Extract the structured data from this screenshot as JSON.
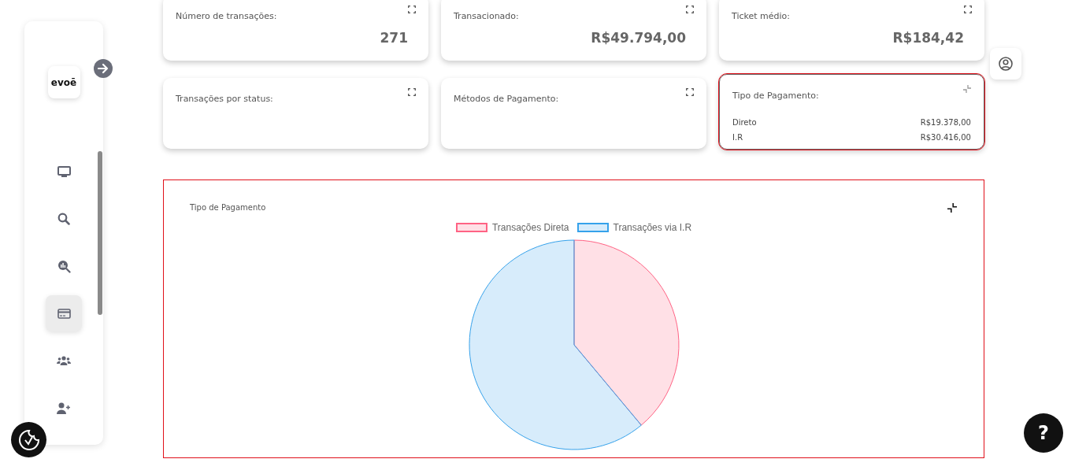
{
  "sidebar": {
    "logo": "evoē",
    "items": [
      {
        "selected": false
      },
      {
        "selected": false
      },
      {
        "selected": false
      },
      {
        "selected": true
      },
      {
        "selected": false
      },
      {
        "selected": false
      }
    ]
  },
  "stat_cards": [
    {
      "title": "Número de transações:",
      "value": "271"
    },
    {
      "title": "Transacionado:",
      "value": "R$49.794,00"
    },
    {
      "title": "Ticket médio:",
      "value": "R$184,42"
    }
  ],
  "detail_cards": [
    {
      "title": "Transações por status:",
      "expanded": false
    },
    {
      "title": "Métodos de Pagamento:",
      "expanded": false
    },
    {
      "title": "Tipo de Pagamento:",
      "expanded": true,
      "rows": [
        {
          "label": "Direto",
          "value": "R$19.378,00"
        },
        {
          "label": "I.R",
          "value": "R$30.416,00"
        }
      ]
    }
  ],
  "chart_panel": {
    "title": "Tipo de Pagamento",
    "chart_data": {
      "type": "pie",
      "categories": [
        "Transações Direta",
        "Transações via I.R"
      ],
      "values": [
        38.92,
        61.08
      ],
      "colors": [
        "#ff6384",
        "#36a2eb"
      ]
    }
  },
  "help_button": {
    "label": "?"
  }
}
